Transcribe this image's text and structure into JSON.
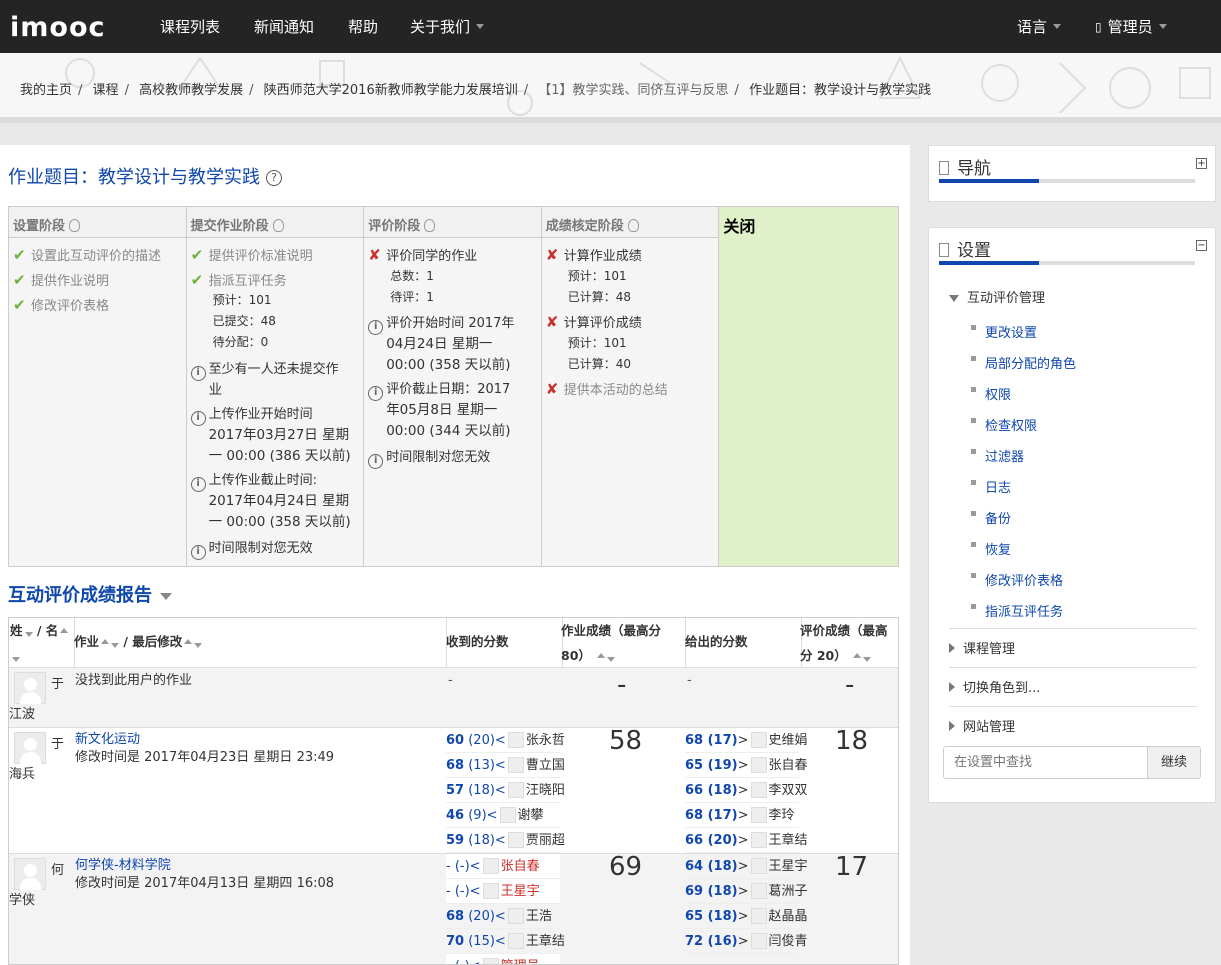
{
  "header": {
    "logo": "imooc",
    "nav": [
      "课程列表",
      "新闻通知",
      "帮助",
      "关于我们"
    ],
    "language": "语言",
    "user": "管理员"
  },
  "breadcrumbs": [
    "我的主页",
    "课程",
    "高校教师教学发展",
    "陕西师范大学2016新教师教学能力发展培训",
    "【1】教学实践、同侪互评与反思",
    "作业题目：教学设计与教学实践"
  ],
  "page_title": "作业题目：教学设计与教学实践",
  "phases": {
    "setup": {
      "title": "设置阶段",
      "tasks": [
        "设置此互动评价的描述",
        "提供作业说明",
        "修改评价表格"
      ]
    },
    "submission": {
      "title": "提交作业阶段",
      "t1": "提供评价标准说明",
      "t2": "指派互评任务",
      "t2_expected": "预计：101",
      "t2_submitted": "已提交：48",
      "t2_toallocate": "待分配：0",
      "i1": [
        "至少有一人还未提交作",
        "业"
      ],
      "i2": [
        "上传作业开始时间",
        "2017年03月27日 星期",
        "一 00:00 (386 天以前)"
      ],
      "i3": [
        "上传作业截止时间:",
        "2017年04月24日 星期",
        "一 00:00 (358 天以前)"
      ],
      "i4": "时间限制对您无效"
    },
    "assessment": {
      "title": "评价阶段",
      "t1": "评价同学的作业",
      "total": "总数：1",
      "pending": "待评：1",
      "i1": [
        "评价开始时间 2017年",
        "04月24日 星期一",
        "00:00 (358 天以前)"
      ],
      "i2": [
        "评价截止日期：2017",
        "年05月8日 星期一",
        "00:00 (344 天以前)"
      ],
      "i3": "时间限制对您无效"
    },
    "evaluation": {
      "title": "成绩核定阶段",
      "t1": "计算作业成绩",
      "t1_expected": "预计：101",
      "t1_done": "已计算：48",
      "t2": "计算评价成绩",
      "t2_expected": "预计：101",
      "t2_done": "已计算：40",
      "t3": "提供本活动的总结"
    },
    "closed": {
      "title": "关闭"
    }
  },
  "report": {
    "title": "互动评价成绩报告",
    "headers": {
      "surname": "姓",
      "firstname": "/ 名",
      "submission": "作业",
      "lastmodified": "/ 最后修改",
      "received": "收到的分数",
      "grade_a": "作业成绩（最高分",
      "grade_b": "80）",
      "given": "给出的分数",
      "gradinggrade_a": "评价成绩（最高",
      "gradinggrade_b": "分 20）"
    },
    "rows": [
      {
        "name_a": "于",
        "name_b": "江波",
        "submission": "没找到此用户的作业",
        "modified": "",
        "grade": "-",
        "gg": "-",
        "received_dash": "-",
        "given_dash": "-"
      },
      {
        "name_a": "于",
        "name_b": "海兵",
        "submission": "新文化运动",
        "modified": "修改时间是 2017年04月23日 星期日 23:49",
        "grade": "58",
        "gg": "18",
        "received": [
          {
            "score": "60",
            "weight": "(20)<",
            "name": "张永哲"
          },
          {
            "score": "68",
            "weight": "(13)<",
            "name": "曹立国"
          },
          {
            "score": "57",
            "weight": "(18)<",
            "name": "汪晓阳"
          },
          {
            "score": "46",
            "weight": "(9)<",
            "name": "谢攀"
          },
          {
            "score": "59",
            "weight": "(18)<",
            "name": "贾丽超"
          }
        ],
        "given": [
          {
            "score": "68",
            "weight": "(17)",
            "name": "史维娟"
          },
          {
            "score": "65",
            "weight": "(19)",
            "name": "张自春"
          },
          {
            "score": "66",
            "weight": "(18)",
            "name": "李双双"
          },
          {
            "score": "68",
            "weight": "(17)",
            "name": "李玲"
          },
          {
            "score": "66",
            "weight": "(20)",
            "name": "王章结"
          }
        ]
      },
      {
        "name_a": "何",
        "name_b": "学侠",
        "submission": "何学侠-材料学院",
        "modified": "修改时间是 2017年04月13日 星期四 16:08",
        "grade": "69",
        "gg": "17",
        "received": [
          {
            "score": "-",
            "weight": "(-)<",
            "name": "张自春"
          },
          {
            "score": "-",
            "weight": "(-)<",
            "name": "王星宇"
          },
          {
            "score": "68",
            "weight": "(20)<",
            "name": "王浩"
          },
          {
            "score": "70",
            "weight": "(15)<",
            "name": "王章结"
          },
          {
            "score": "-",
            "weight": "(-)<",
            "name": "管理员"
          }
        ],
        "given": [
          {
            "score": "64",
            "weight": "(18)",
            "name": "王星宇"
          },
          {
            "score": "69",
            "weight": "(18)",
            "name": "葛洲子"
          },
          {
            "score": "65",
            "weight": "(18)",
            "name": "赵晶晶"
          },
          {
            "score": "72",
            "weight": "(16)",
            "name": "闫俊青"
          }
        ]
      }
    ]
  },
  "navigation_block": {
    "title": "导航"
  },
  "settings_block": {
    "title": "设置",
    "group": "互动评价管理",
    "items": [
      "更改设置",
      "局部分配的角色",
      "权限",
      "检查权限",
      "过滤器",
      "日志",
      "备份",
      "恢复",
      "修改评价表格",
      "指派互评任务"
    ],
    "collapsed": [
      "课程管理",
      "切换角色到...",
      "网站管理"
    ],
    "search_placeholder": "在设置中查找",
    "search_button": "继续"
  },
  "colors": {
    "accent": "#0f47ad",
    "topbar": "#242424",
    "closed_phase": "#e0f0c8",
    "done": "#6db33f",
    "todo": "#c9302c"
  }
}
